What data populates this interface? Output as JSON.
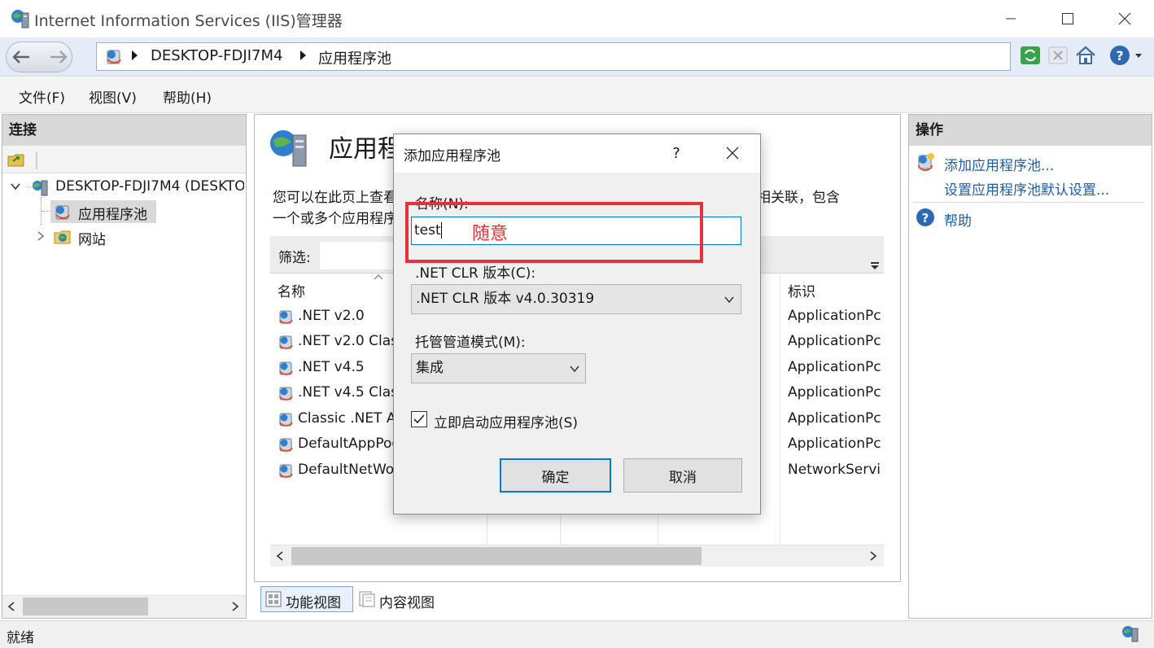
{
  "window": {
    "title": "Internet Information Services (IIS)管理器",
    "minimize_icon": "minimize-icon",
    "maximize_icon": "maximize-icon",
    "close_icon": "close-icon"
  },
  "address_bar": {
    "breadcrumbs": [
      "DESKTOP-FDJI7M4",
      "应用程序池"
    ]
  },
  "menu": {
    "items": [
      "文件(F)",
      "视图(V)",
      "帮助(H)"
    ]
  },
  "connections": {
    "title": "连接",
    "tree": {
      "server": "DESKTOP-FDJI7M4 (DESKTOP",
      "app_pools": "应用程序池",
      "sites": "网站"
    }
  },
  "center": {
    "title": "应用程序池",
    "description_line1": "您可以在此页上查看和管理服务器上的应用程序池列表。应用程序池与工作进程相关联，包含",
    "description_line2": "一个或多个应用程序，并提供不同应用程序之间的隔离。",
    "filter_label": "筛选:",
    "columns": [
      "名称",
      "标识"
    ],
    "rows": [
      {
        "name": ".NET v2.0",
        "identity": "ApplicationPc"
      },
      {
        "name": ".NET v2.0 Classic",
        "identity": "ApplicationPc"
      },
      {
        "name": ".NET v4.5",
        "identity": "ApplicationPc"
      },
      {
        "name": ".NET v4.5 Classic",
        "identity": "ApplicationPc"
      },
      {
        "name": "Classic .NET AppPool",
        "identity": "ApplicationPc"
      },
      {
        "name": "DefaultAppPool",
        "identity": "ApplicationPc"
      },
      {
        "name": "DefaultNetWorkAppPool",
        "identity": "NetworkServi"
      }
    ],
    "view_tabs": [
      "功能视图",
      "内容视图"
    ]
  },
  "actions": {
    "title": "操作",
    "add_pool": "添加应用程序池...",
    "set_defaults": "设置应用程序池默认设置...",
    "help": "帮助"
  },
  "status": {
    "text": "就绪"
  },
  "dialog": {
    "title": "添加应用程序池",
    "help_glyph": "?",
    "name_label": "名称(N):",
    "name_value": "test",
    "annotation": "随意",
    "clr_label": ".NET CLR 版本(C):",
    "clr_value": ".NET CLR 版本 v4.0.30319",
    "pipeline_label": "托管管道模式(M):",
    "pipeline_value": "集成",
    "start_checkbox_label": "立即启动应用程序池(S)",
    "start_checked": true,
    "ok_label": "确定",
    "cancel_label": "取消"
  },
  "colors": {
    "annotation_red": "#e8303a",
    "focus_blue": "#0078d7",
    "link_blue": "#1d5fa7"
  }
}
